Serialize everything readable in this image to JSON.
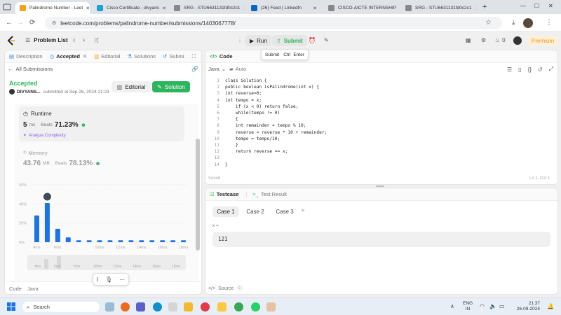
{
  "browser": {
    "tabs": [
      {
        "title": "Palindrome Number - Leet",
        "color": "#f89f1b"
      },
      {
        "title": "Cisco Certificate - divyans",
        "color": "#1ba0d7"
      },
      {
        "title": "SRG - STU6631131fd0c2c1",
        "color": "#888888"
      },
      {
        "title": "(26) Feed | LinkedIn",
        "color": "#0a66c2"
      },
      {
        "title": "CISCO-AICTE INTERNSHIP",
        "color": "#888888"
      },
      {
        "title": "SRG - STU6631131fd0c2c1",
        "color": "#888888"
      }
    ],
    "new_tab": "+",
    "url": "leetcode.com/problems/palindrome-number/submissions/1403067778/"
  },
  "header": {
    "problem_list": "Problem List",
    "run": "Run",
    "submit": "Submit",
    "submit_tooltip": [
      "Submit",
      "Ctrl",
      "Enter"
    ],
    "streak": "0",
    "premium": "Premium"
  },
  "left": {
    "tabs": [
      "Description",
      "Accepted",
      "Editorial",
      "Solutions",
      "Submi"
    ],
    "all_submissions": "All Submissions",
    "status": "Accepted",
    "user": "DIVYANS...",
    "submitted": "submitted at Sep 26, 2024 21:23",
    "editorial_btn": "Editorial",
    "solution_btn": "Solution",
    "runtime_label": "Runtime",
    "runtime_value": "5",
    "runtime_unit": "ms",
    "beats_label": "Beats",
    "runtime_beats": "71.23%",
    "analyze": "Analyze Complexity",
    "memory_label": "Memory",
    "memory_value": "43.76",
    "memory_unit": "MB",
    "memory_beats": "78.13%",
    "footer_code": "Code",
    "footer_lang": "Java"
  },
  "chart_data": {
    "type": "bar",
    "ylim": [
      0,
      60
    ],
    "yticks": [
      "60%",
      "40%",
      "20%",
      "0%"
    ],
    "categories": [
      "4ms",
      "5ms",
      "6ms",
      "7ms",
      "8ms",
      "9ms",
      "10ms",
      "11ms",
      "12ms",
      "13ms",
      "14ms",
      "15ms",
      "16ms",
      "17ms",
      "18ms"
    ],
    "values": [
      28,
      41,
      14,
      5,
      2,
      2,
      2,
      2,
      2,
      2,
      2,
      2,
      2,
      2,
      2
    ],
    "xtick_labels": [
      "4ms",
      "6ms",
      "10ms",
      "12ms",
      "14ms",
      "16ms",
      "18ms"
    ],
    "mini_labels": [
      "4ms",
      "5ms",
      "6ms",
      "10ms",
      "12ms",
      "14ms",
      "16ms",
      "18ms"
    ],
    "highlight_index": 1,
    "colors": {
      "bar": "#1a73e8"
    }
  },
  "editor": {
    "title": "Code",
    "lang": "Java",
    "auto": "Auto",
    "saved": "Saved",
    "cursor": "Ln 1, Col 1",
    "lines": [
      "class Solution {",
      "public boolean isPalindrome(int x) {",
      "int reverse=0;",
      "int tempo = x;",
      "    if (x < 0) return false;",
      "    while(tempo != 0)",
      "    {",
      "    int remainder = tempo % 10;",
      "    reverse = reverse * 10 + remainder;",
      "    tempo = tempo/10;",
      "    }",
      "    return reverse == x;",
      "",
      "}"
    ]
  },
  "testcase": {
    "tab1": "Testcase",
    "tab2": "Test Result",
    "cases": [
      "Case 1",
      "Case 2",
      "Case 3"
    ],
    "add": "+",
    "var_label": "x =",
    "value": "121",
    "source": "Source"
  },
  "toolbar_float": {
    "mic": "mic"
  },
  "taskbar": {
    "search": "Search",
    "lang_line1": "ENG",
    "lang_line2": "IN",
    "time": "21:37",
    "date": "26-09-2024"
  }
}
